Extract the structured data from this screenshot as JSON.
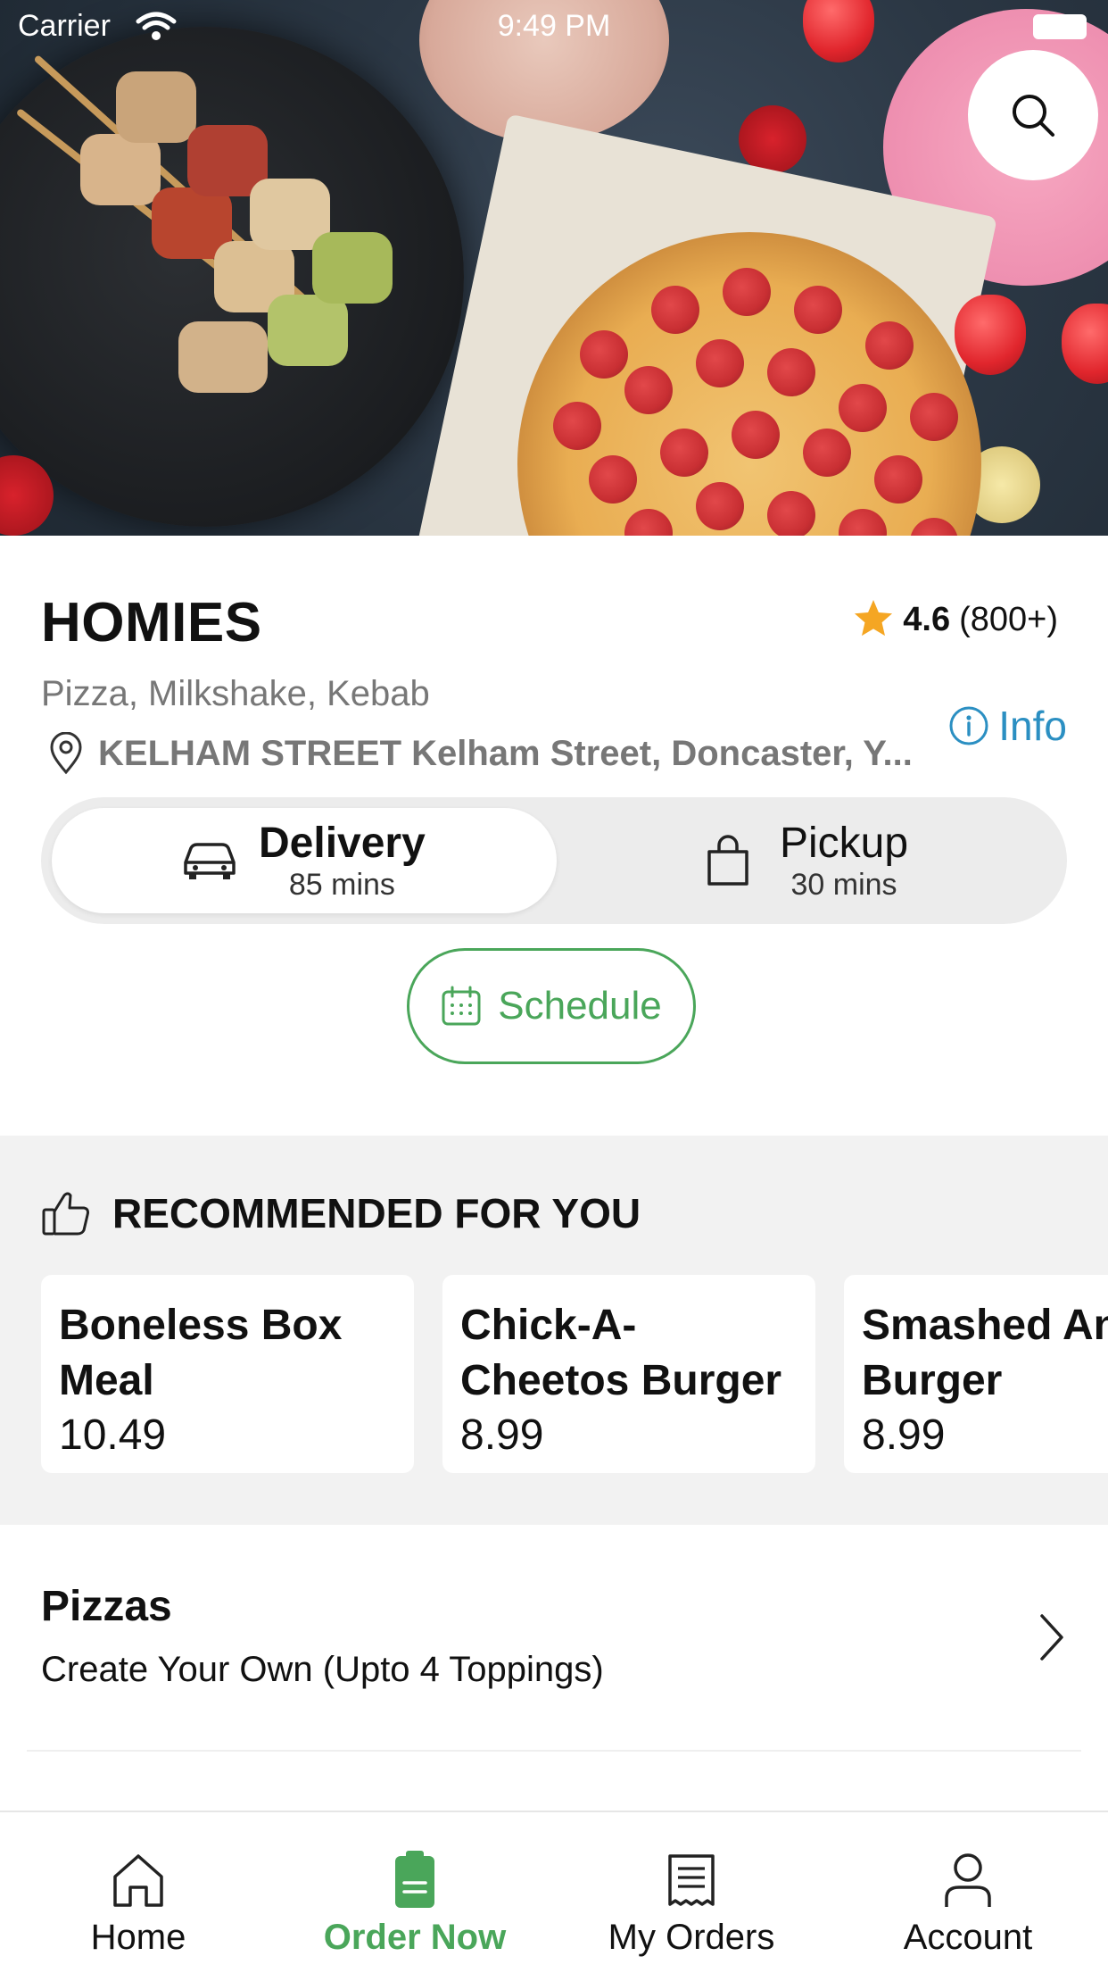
{
  "status_bar": {
    "carrier": "Carrier",
    "time": "9:49 PM"
  },
  "restaurant": {
    "name": "HOMIES",
    "rating_value": "4.6",
    "rating_count": "(800+)",
    "cuisines": "Pizza, Milkshake, Kebab",
    "info_label": "Info",
    "address": "KELHAM STREET Kelham Street, Doncaster, Y..."
  },
  "order_mode": {
    "delivery": {
      "label": "Delivery",
      "time": "85 mins",
      "selected": true
    },
    "pickup": {
      "label": "Pickup",
      "time": "30 mins",
      "selected": false
    },
    "schedule_label": "Schedule"
  },
  "recommended": {
    "title": "RECOMMENDED FOR YOU",
    "items": [
      {
        "name_line1": "Boneless Box",
        "name_line2": "Meal",
        "price": "10.49"
      },
      {
        "name_line1": "Chick-A-",
        "name_line2": "Cheetos Burger",
        "price": "8.99"
      },
      {
        "name_line1": "Smashed An",
        "name_line2": "Burger",
        "price": "8.99"
      }
    ]
  },
  "category": {
    "title": "Pizzas",
    "subtitle": "Create Your Own (Upto 4 Toppings)"
  },
  "tabbar": {
    "tabs": [
      {
        "label": "Home",
        "icon": "home-icon"
      },
      {
        "label": "Order Now",
        "icon": "order-icon",
        "active": true
      },
      {
        "label": "My Orders",
        "icon": "receipt-icon"
      },
      {
        "label": "Account",
        "icon": "user-icon"
      }
    ]
  },
  "colors": {
    "accent_green": "#4aa65a",
    "info_blue": "#2b8fc2",
    "star": "#f5a623"
  }
}
